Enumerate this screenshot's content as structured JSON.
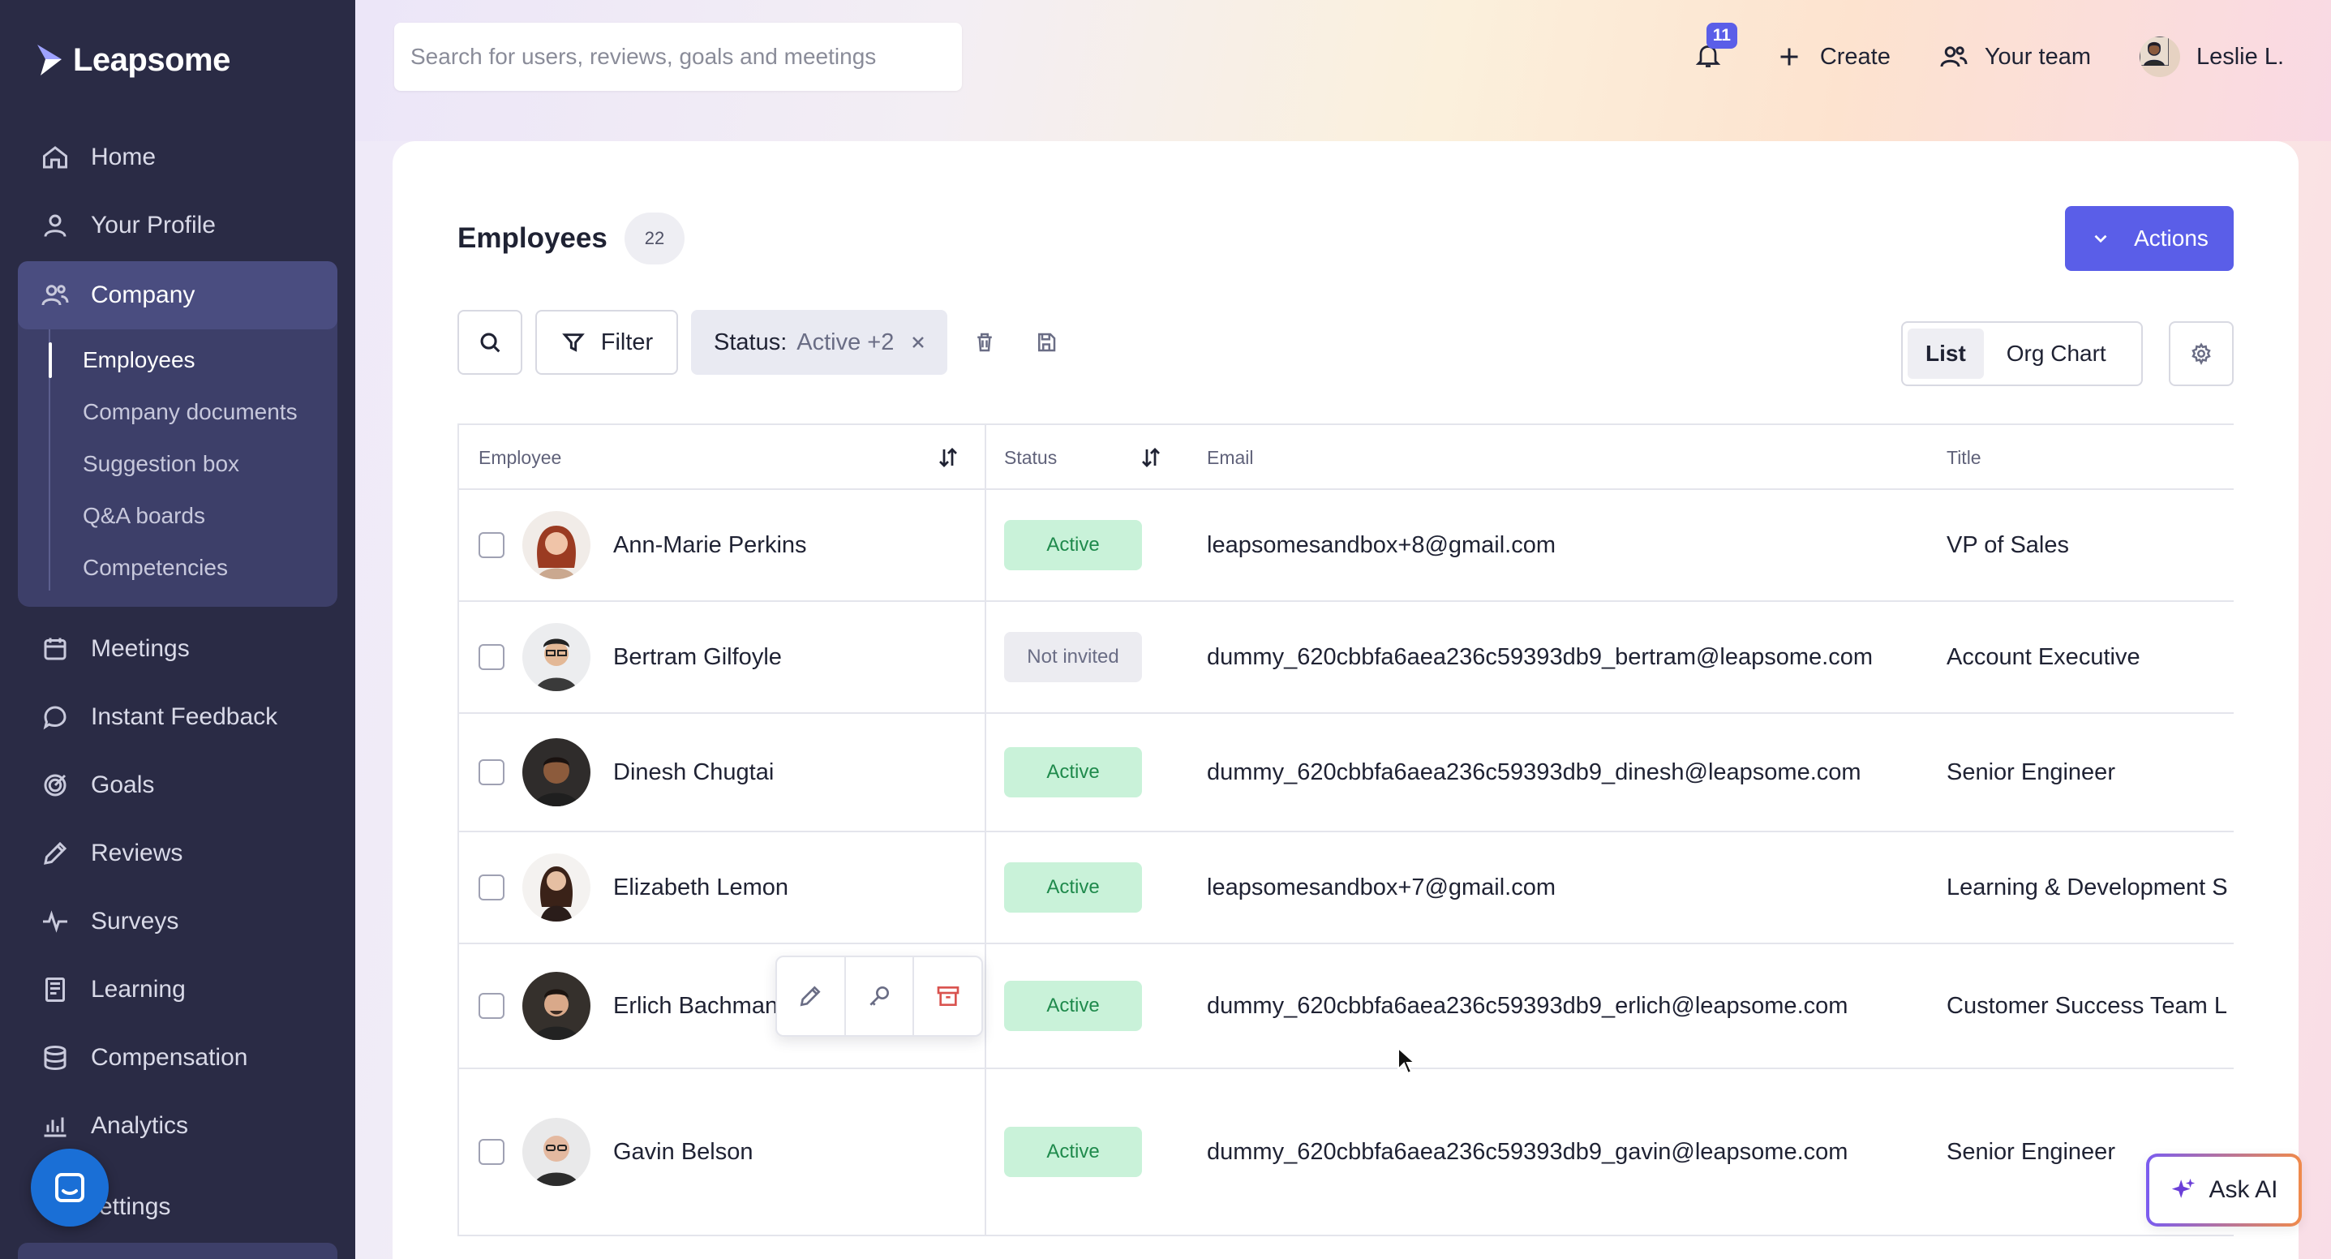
{
  "app": {
    "name": "Leapsome"
  },
  "sidebar": {
    "items": [
      {
        "label": "Home",
        "icon": "home-icon"
      },
      {
        "label": "Your Profile",
        "icon": "user-icon"
      },
      {
        "label": "Company",
        "icon": "users-icon",
        "active": true
      },
      {
        "label": "Meetings",
        "icon": "calendar-icon"
      },
      {
        "label": "Instant Feedback",
        "icon": "chat-icon"
      },
      {
        "label": "Goals",
        "icon": "target-icon"
      },
      {
        "label": "Reviews",
        "icon": "pen-icon"
      },
      {
        "label": "Surveys",
        "icon": "pulse-icon"
      },
      {
        "label": "Learning",
        "icon": "book-icon"
      },
      {
        "label": "Compensation",
        "icon": "coins-icon"
      },
      {
        "label": "Analytics",
        "icon": "bar-chart-icon"
      }
    ],
    "company_subitems": [
      {
        "label": "Employees",
        "active": true
      },
      {
        "label": "Company documents"
      },
      {
        "label": "Suggestion box"
      },
      {
        "label": "Q&A boards"
      },
      {
        "label": "Competencies"
      }
    ],
    "settings_label": "ettings"
  },
  "topbar": {
    "search_placeholder": "Search for users, reviews, goals and meetings",
    "notification_count": "11",
    "create_label": "Create",
    "team_label": "Your team",
    "user_name": "Leslie L."
  },
  "page": {
    "title": "Employees",
    "count": "22",
    "actions_label": "Actions",
    "filter_label": "Filter",
    "status_filter_key": "Status:",
    "status_filter_value": "Active +2",
    "view_options": [
      "List",
      "Org Chart"
    ],
    "active_view": "List"
  },
  "table": {
    "columns": [
      "Employee",
      "Status",
      "Email",
      "Title"
    ],
    "rows": [
      {
        "name": "Ann-Marie Perkins",
        "status": "Active",
        "email": "leapsomesandbox+8@gmail.com",
        "title": "VP of Sales"
      },
      {
        "name": "Bertram Gilfoyle",
        "status": "Not invited",
        "email": "dummy_620cbbfa6aea236c59393db9_bertram@leapsome.com",
        "title": "Account Executive"
      },
      {
        "name": "Dinesh Chugtai",
        "status": "Active",
        "email": "dummy_620cbbfa6aea236c59393db9_dinesh@leapsome.com",
        "title": "Senior Engineer"
      },
      {
        "name": "Elizabeth Lemon",
        "status": "Active",
        "email": "leapsomesandbox+7@gmail.com",
        "title": "Learning & Development S"
      },
      {
        "name": "Erlich Bachman",
        "status": "Active",
        "email": "dummy_620cbbfa6aea236c59393db9_erlich@leapsome.com",
        "title": "Customer Success Team L"
      },
      {
        "name": "Gavin Belson",
        "status": "Active",
        "email": "dummy_620cbbfa6aea236c59393db9_gavin@leapsome.com",
        "title": "Senior Engineer"
      }
    ]
  },
  "ask_ai_label": "Ask AI",
  "colors": {
    "sidebar": "#2a2b45",
    "accent": "#5a5ee8",
    "active_badge_bg": "#c9f2d9",
    "active_badge_text": "#1f8a4c"
  }
}
